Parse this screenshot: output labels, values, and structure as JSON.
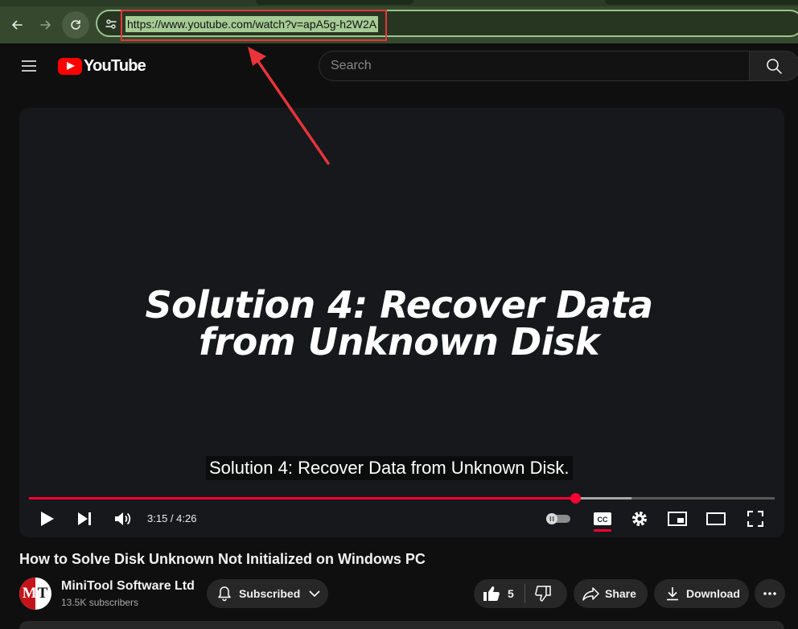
{
  "browser": {
    "url": "https://www.youtube.com/watch?v=apA5g-h2W2A"
  },
  "header": {
    "logo_text": "YouTube",
    "search_placeholder": "Search"
  },
  "player": {
    "slide_title_line1": "Solution 4: Recover Data",
    "slide_title_line2": "from Unknown Disk",
    "caption": "Solution 4: Recover Data from Unknown Disk.",
    "current_time": "3:15",
    "duration": "4:26",
    "time_display": "3:15 / 4:26",
    "played_fraction": 0.733,
    "buffered_fraction": 0.808
  },
  "video": {
    "title": "How to Solve Disk Unknown Not Initialized on Windows PC"
  },
  "channel": {
    "name": "MiniTool Software Ltd",
    "subscribers": "13.5K subscribers",
    "avatar_letters": "MT"
  },
  "actions": {
    "subscribed_label": "Subscribed",
    "like_count": "5",
    "share_label": "Share",
    "download_label": "Download"
  },
  "icons": {
    "back": "back-arrow-icon",
    "forward": "forward-arrow-icon",
    "reload": "reload-icon",
    "site_info": "tune-icon",
    "menu": "hamburger-menu-icon",
    "search": "search-icon",
    "play": "play-icon",
    "next": "skip-next-icon",
    "volume": "volume-icon",
    "autoplay": "autoplay-toggle-icon",
    "captions": "closed-captions-icon",
    "settings": "gear-icon",
    "miniplayer": "miniplayer-icon",
    "theater": "theater-mode-icon",
    "fullscreen": "fullscreen-icon",
    "bell": "bell-icon",
    "like": "thumbs-up-icon",
    "dislike": "thumbs-down-icon",
    "share": "share-arrow-icon",
    "download": "download-icon",
    "more": "more-dots-icon"
  },
  "colors": {
    "accent_red": "#ff0033",
    "annotation_red": "#e8343a",
    "browser_toolbar": "#36492f",
    "url_highlight": "#a6cc95"
  }
}
